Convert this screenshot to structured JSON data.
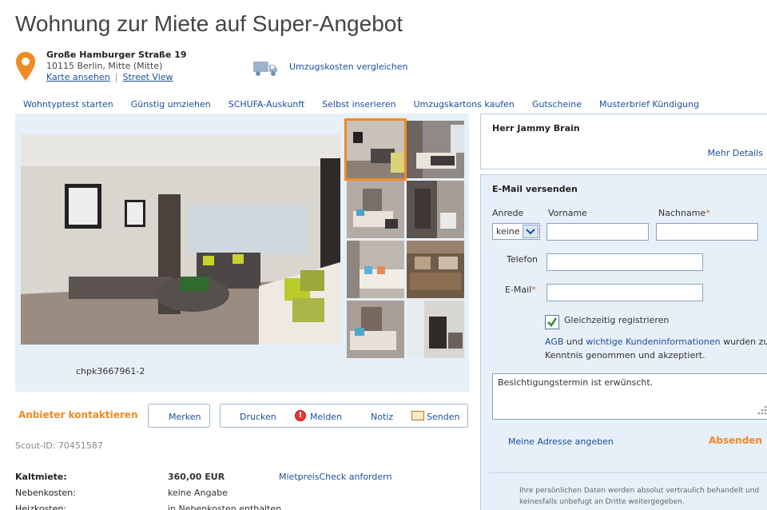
{
  "page": {
    "title": "Wohnung zur Miete auf Super-Angebot"
  },
  "address": {
    "street": "Große Hamburger Straße 19",
    "city": "10115 Berlin, Mitte (Mitte)",
    "map_link": "Karte ansehen",
    "streetview_link": "Street View",
    "icon": "map-pin-icon"
  },
  "moving": {
    "label": "Umzugskosten vergleichen",
    "icon": "truck-icon"
  },
  "nav": [
    "Wohntyptest starten",
    "Günstig umziehen",
    "SCHUFA-Auskunft",
    "Selbst inserieren",
    "Umzugskartons kaufen",
    "Gutscheine",
    "Musterbrief Kündigung"
  ],
  "gallery": {
    "photo_id": "chpk3667961-2",
    "thumbnail_count": 8
  },
  "actions": {
    "contact": "Anbieter kontaktieren",
    "save": "Merken",
    "print": "Drucken",
    "report": "Melden",
    "note": "Notiz",
    "send": "Senden"
  },
  "scout_id": "Scout-ID: 70451587",
  "details": [
    {
      "label": "Kaltmiete:",
      "value": "360,00 EUR",
      "link": "MietpreisCheck anfordern"
    },
    {
      "label": "Nebenkosten:",
      "value": "keine Angabe"
    },
    {
      "label": "Heizkosten:",
      "value": "in Nebenkosten enthalten"
    }
  ],
  "provider": {
    "name": "Herr Jammy Brain",
    "more": "Mehr Details"
  },
  "mail_form": {
    "title": "E-Mail versenden",
    "anrede_label": "Anrede",
    "anrede_value": "keine",
    "vorname_label": "Vorname",
    "nachname_label": "Nachname",
    "telefon_label": "Telefon",
    "email_label": "E-Mail",
    "required_mark": "*",
    "register_label": "Gleichzeitig registrieren",
    "terms_link1": "AGB",
    "terms_and": " und ",
    "terms_link2": "wichtige Kundeninformationen",
    "terms_rest": " wurden zur Kenntnis genommen und akzeptiert.",
    "message": "Besichtigungstermin ist erwünscht.",
    "address_link": "Meine Adresse angeben",
    "send_label": "Absenden",
    "privacy": "Ihre persönlichen Daten werden absolut vertraulich behandelt und keinesfalls unbefugt an Dritte weitergegeben."
  },
  "colors": {
    "accent": "#f08a24",
    "link": "#1a4f9c",
    "panel_bg": "#e7eff8"
  }
}
